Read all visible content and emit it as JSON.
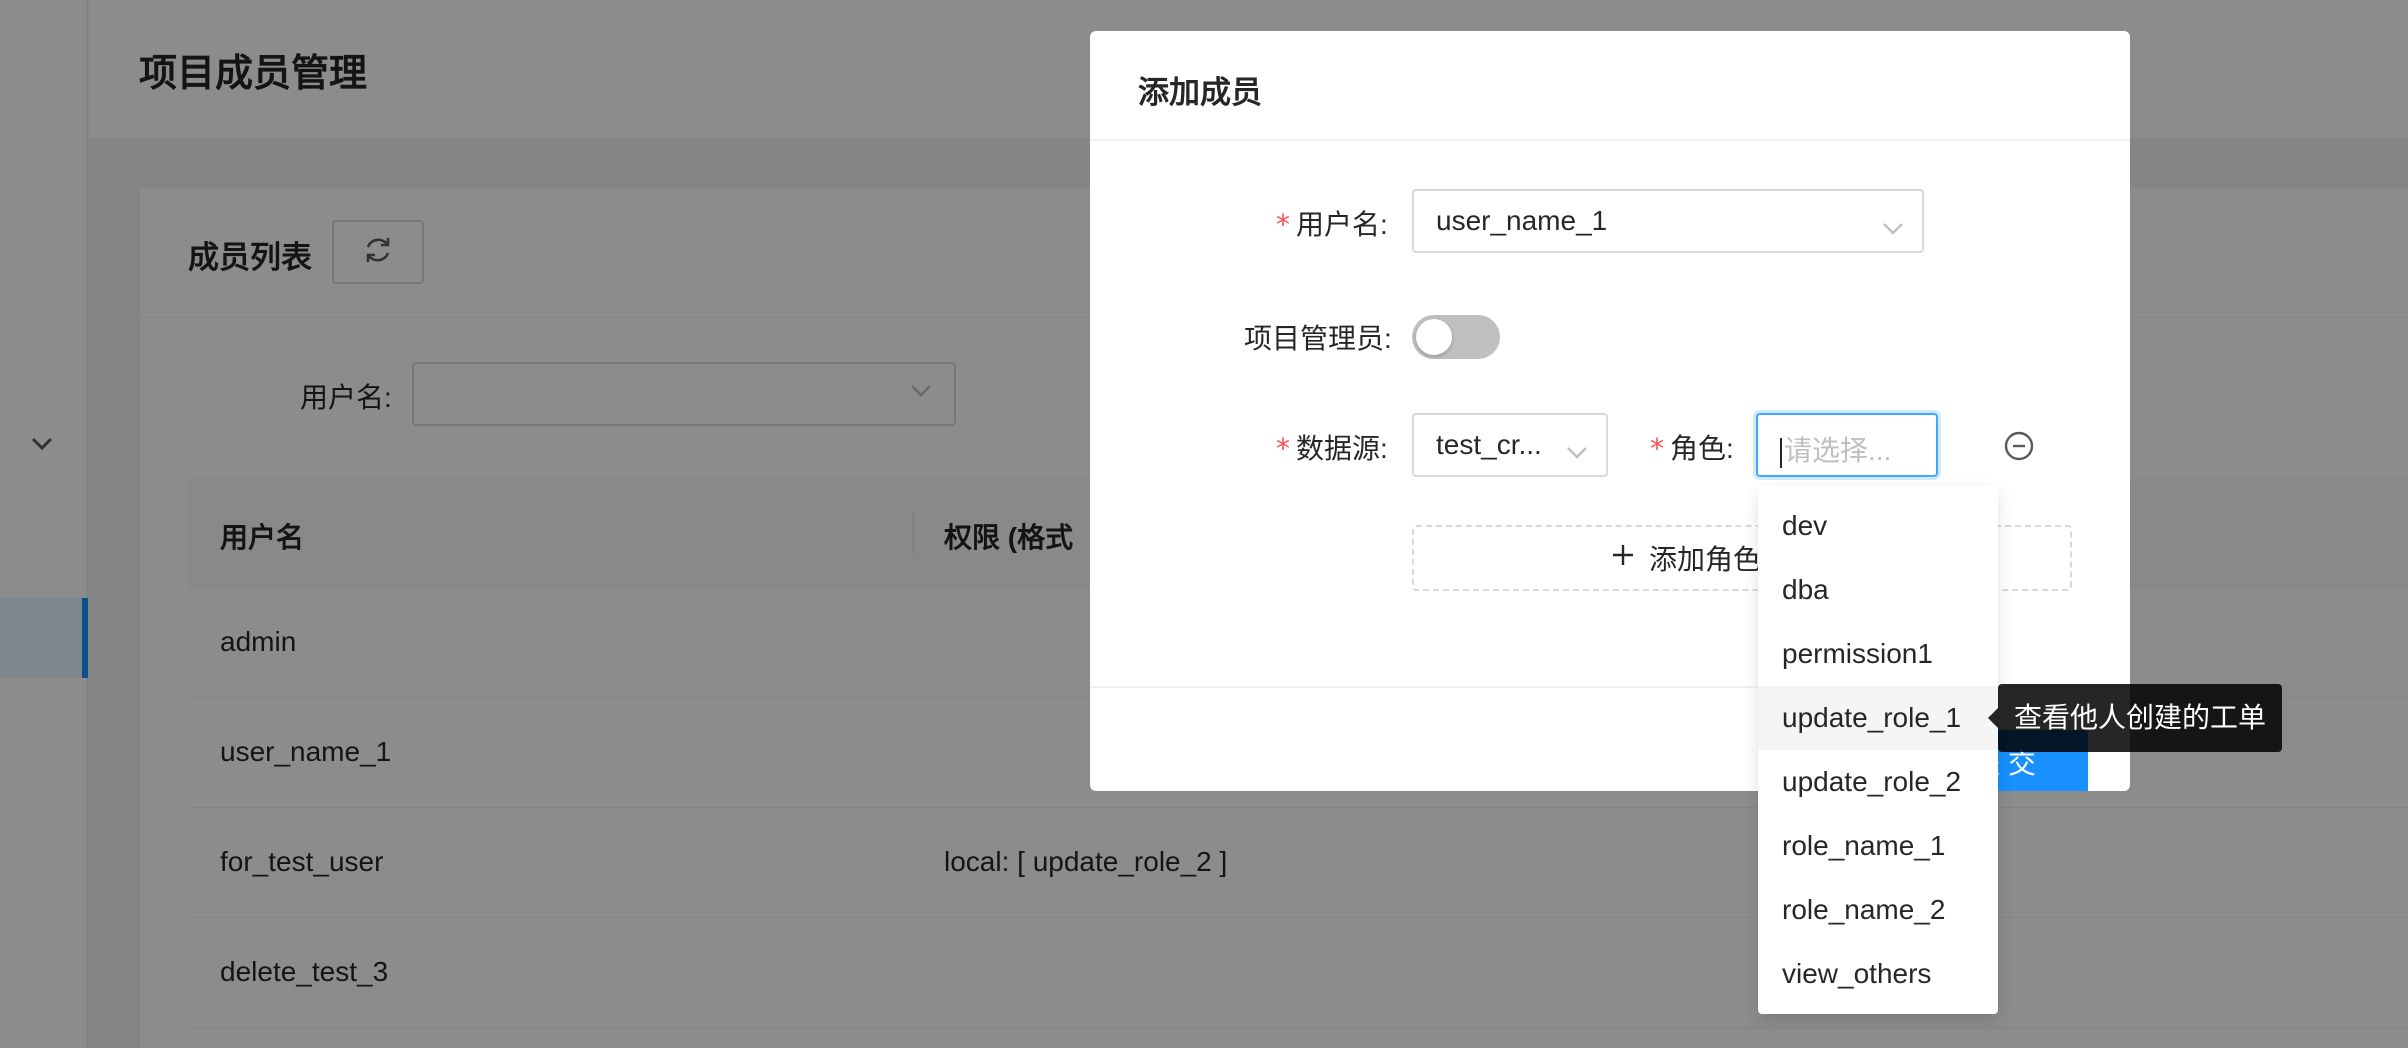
{
  "page": {
    "title": "项目成员管理"
  },
  "card": {
    "title": "成员列表",
    "refresh_icon": "refresh-icon"
  },
  "filter": {
    "username_label": "用户名:",
    "username_value": ""
  },
  "table": {
    "headers": [
      "用户名",
      "权限 (格式"
    ],
    "rows": [
      {
        "username": "admin",
        "permission": ""
      },
      {
        "username": "user_name_1",
        "permission": ""
      },
      {
        "username": "for_test_user",
        "permission": "local: [ update_role_2 ]"
      },
      {
        "username": "delete_test_3",
        "permission": ""
      }
    ]
  },
  "modal": {
    "title": "添加成员",
    "username_label": "用户名:",
    "username_value": "user_name_1",
    "admin_label": "项目管理员:",
    "admin_on": false,
    "datasource_label": "数据源:",
    "datasource_value": "test_cr...",
    "role_label": "角色:",
    "role_placeholder": "请选择...",
    "add_button": "添加角色与数据源",
    "submit_button": "提 交"
  },
  "role_dropdown": {
    "options": [
      "dev",
      "dba",
      "permission1",
      "update_role_1",
      "update_role_2",
      "role_name_1",
      "role_name_2",
      "view_others"
    ],
    "hovered": "update_role_1"
  },
  "tooltip": {
    "text": "查看他人创建的工单"
  },
  "colors": {
    "primary": "#1890ff",
    "required": "#ff4d4f",
    "mask": "rgba(0,0,0,0.45)"
  }
}
